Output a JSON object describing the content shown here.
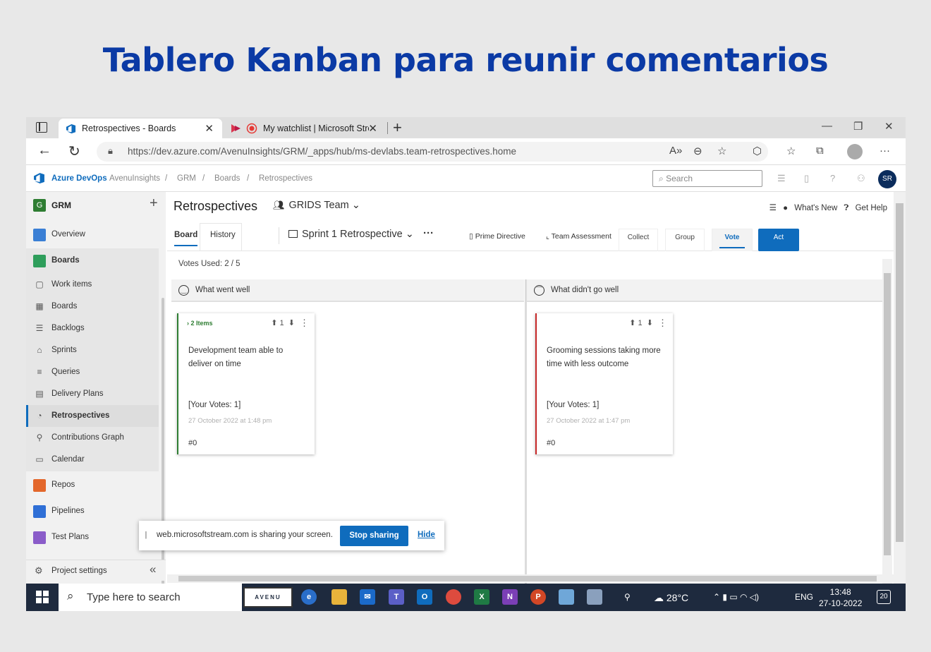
{
  "slide": {
    "title": "Tablero Kanban para reunir comentarios"
  },
  "browser": {
    "tabs": [
      {
        "label": "Retrospectives - Boards",
        "active": true
      },
      {
        "label": "My watchlist | Microsoft Stre",
        "active": false
      }
    ],
    "url": "https://dev.azure.com/AvenuInsights/GRM/_apps/hub/ms-devlabs.team-retrospectives.home"
  },
  "ado": {
    "brand": "Azure DevOps",
    "breadcrumb": [
      "AvenuInsights",
      "/",
      "GRM",
      "/",
      "Boards",
      "/",
      "Retrospectives"
    ],
    "search_placeholder": "Search",
    "user_initials": "SR"
  },
  "sidebar": {
    "project": "GRM",
    "project_initial": "G",
    "items": [
      {
        "label": "Overview",
        "icon": "overview-icon"
      },
      {
        "label": "Boards",
        "icon": "boards-icon"
      },
      {
        "label": "Work items",
        "icon": "work-items-icon"
      },
      {
        "label": "Boards",
        "icon": "board-icon"
      },
      {
        "label": "Backlogs",
        "icon": "backlogs-icon"
      },
      {
        "label": "Sprints",
        "icon": "sprints-icon"
      },
      {
        "label": "Queries",
        "icon": "queries-icon"
      },
      {
        "label": "Delivery Plans",
        "icon": "delivery-plans-icon"
      },
      {
        "label": "Retrospectives",
        "icon": "retrospectives-icon"
      },
      {
        "label": "Contributions Graph",
        "icon": "contributions-icon"
      },
      {
        "label": "Calendar",
        "icon": "calendar-icon"
      },
      {
        "label": "Repos",
        "icon": "repos-icon"
      },
      {
        "label": "Pipelines",
        "icon": "pipelines-icon"
      },
      {
        "label": "Test Plans",
        "icon": "test-plans-icon"
      }
    ],
    "settings": "Project settings"
  },
  "main": {
    "title": "Retrospectives",
    "team": "GRIDS Team",
    "whats_new": "What's New",
    "get_help": "Get Help",
    "pivots": [
      "Board",
      "History"
    ],
    "sprint": "Sprint 1 Retrospective",
    "prime_directive": "Prime Directive",
    "team_assessment": "Team Assessment",
    "stages": [
      "Collect",
      "Group",
      "Vote",
      "Act"
    ],
    "votes_used": "Votes Used: 2 / 5",
    "columns": [
      {
        "title": "What went well",
        "card": {
          "items": "2 Items",
          "votes": "1",
          "text": "Development team able to deliver on time",
          "your_votes": "[Your Votes: 1]",
          "date": "27 October 2022 at 1:48 pm",
          "number": "#0"
        }
      },
      {
        "title": "What didn't go well",
        "card": {
          "votes": "1",
          "text": "Grooming sessions taking more time with less outcome",
          "your_votes": "[Your Votes: 1]",
          "date": "27 October 2022 at 1:47 pm",
          "number": "#0"
        }
      }
    ]
  },
  "sharing": {
    "message": "web.microsoftstream.com is sharing your screen.",
    "stop": "Stop sharing",
    "hide": "Hide"
  },
  "taskbar": {
    "search": "Type here to search",
    "aveu": "AVENU",
    "temperature": "28°C",
    "lang": "ENG",
    "time": "13:48",
    "date": "27-10-2022",
    "notifications": "20"
  },
  "colors": {
    "title": "#0b3aa5",
    "accent": "#0f6cbd",
    "good": "#2e7d32",
    "bad": "#c62828"
  }
}
